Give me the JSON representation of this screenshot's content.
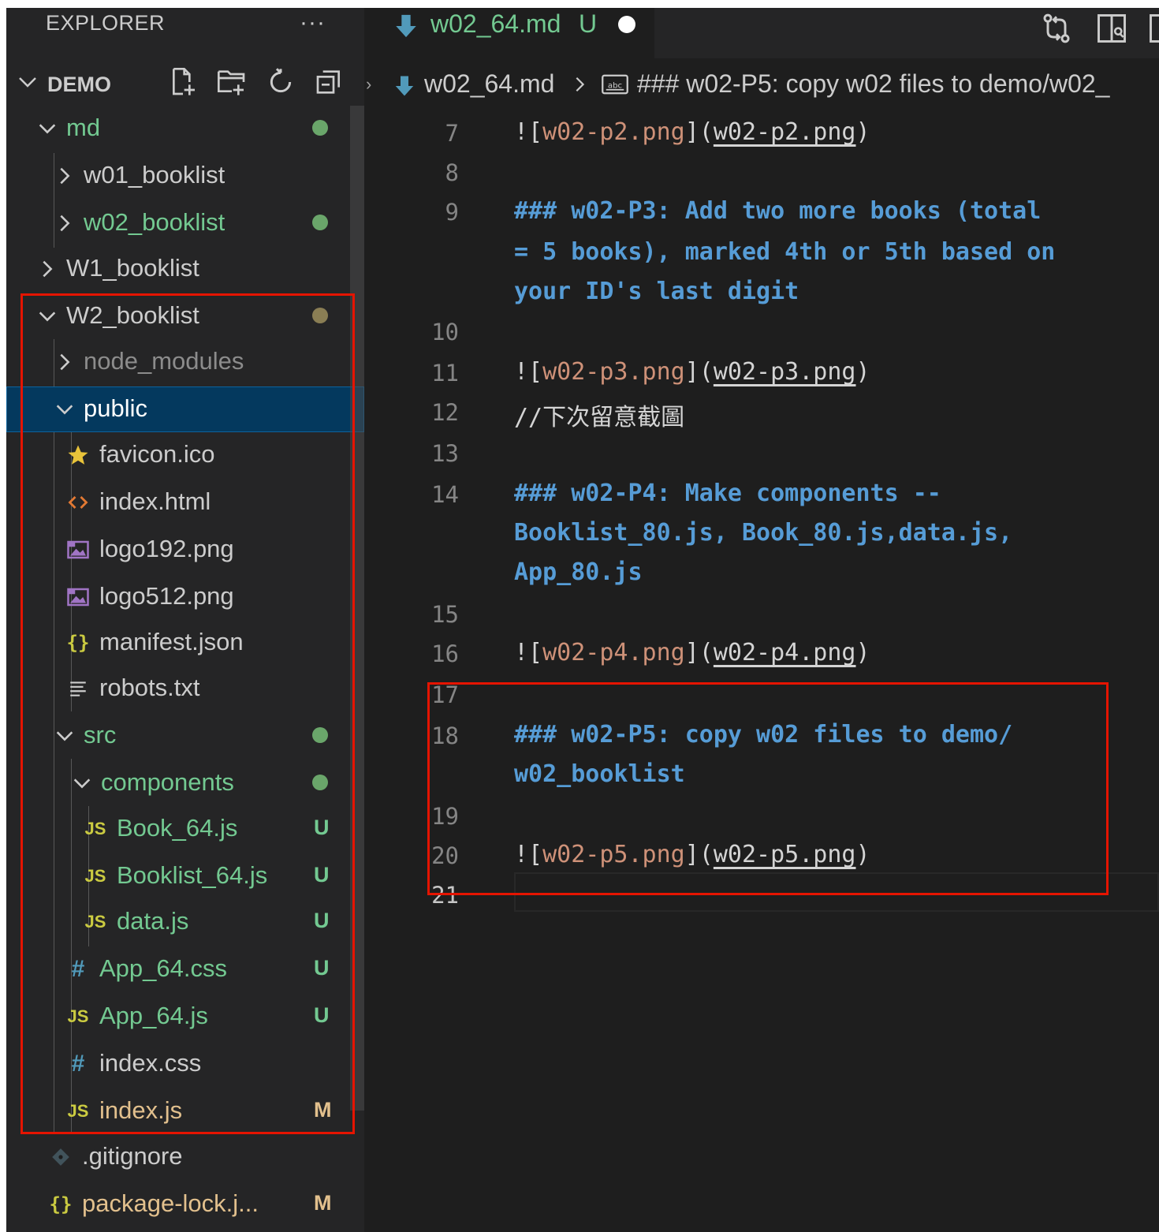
{
  "explorer": {
    "title": "EXPLORER",
    "more": "···",
    "workspace": "DEMO"
  },
  "tree": [
    {
      "label": "md",
      "status": "",
      "dot": "green"
    },
    {
      "label": "w01_booklist",
      "status": ""
    },
    {
      "label": "w02_booklist",
      "status": "",
      "dot": "green"
    },
    {
      "label": "W1_booklist",
      "status": ""
    },
    {
      "label": "W2_booklist",
      "status": "",
      "dot": "olive"
    },
    {
      "label": "node_modules",
      "status": ""
    },
    {
      "label": "public",
      "status": ""
    },
    {
      "label": "favicon.ico",
      "status": ""
    },
    {
      "label": "index.html",
      "status": ""
    },
    {
      "label": "logo192.png",
      "status": ""
    },
    {
      "label": "logo512.png",
      "status": ""
    },
    {
      "label": "manifest.json",
      "status": ""
    },
    {
      "label": "robots.txt",
      "status": ""
    },
    {
      "label": "src",
      "status": "",
      "dot": "green"
    },
    {
      "label": "components",
      "status": "",
      "dot": "green"
    },
    {
      "label": "Book_64.js",
      "status": "U"
    },
    {
      "label": "Booklist_64.js",
      "status": "U"
    },
    {
      "label": "data.js",
      "status": "U"
    },
    {
      "label": "App_64.css",
      "status": "U"
    },
    {
      "label": "App_64.js",
      "status": "U"
    },
    {
      "label": "index.css",
      "status": ""
    },
    {
      "label": "index.js",
      "status": "M"
    },
    {
      "label": ".gitignore",
      "status": ""
    },
    {
      "label": "package-lock.j...",
      "status": "M"
    }
  ],
  "editor": {
    "tab": {
      "name": "w02_64.md",
      "status": "U"
    },
    "breadcrumb": {
      "file": "w02_64.md",
      "heading": "### w02-P5: copy w02 files to demo/w02_"
    },
    "lines": [
      {
        "n": "7",
        "parts": [
          "![",
          "w02-p2.png",
          "](",
          "w02-p2.png",
          ")"
        ]
      },
      {
        "n": "8"
      },
      {
        "n": "9",
        "wrap": [
          "### w02-P3: Add two more books (total",
          "= 5 books), marked 4th or 5th based on",
          "your ID's last digit"
        ]
      },
      {
        "n": "10"
      },
      {
        "n": "11",
        "parts": [
          "![",
          "w02-p3.png",
          "](",
          "w02-p3.png",
          ")"
        ]
      },
      {
        "n": "12",
        "text": "//下次留意截圖"
      },
      {
        "n": "13"
      },
      {
        "n": "14",
        "wrap": [
          "### w02-P4: Make components --",
          "Booklist_80.js, Book_80.js,data.js,",
          "App_80.js"
        ]
      },
      {
        "n": "15"
      },
      {
        "n": "16",
        "parts": [
          "![",
          "w02-p4.png",
          "](",
          "w02-p4.png",
          ")"
        ]
      },
      {
        "n": "17"
      },
      {
        "n": "18",
        "wrap": [
          "### w02-P5: copy w02 files to demo/",
          "w02_booklist"
        ]
      },
      {
        "n": "19"
      },
      {
        "n": "20",
        "parts": [
          "![",
          "w02-p5.png",
          "](",
          "w02-p5.png",
          ")"
        ]
      },
      {
        "n": "21"
      }
    ]
  },
  "colors": {
    "untracked": "#73c991",
    "modified": "#e2c08d",
    "heading": "#569cd6",
    "link_text": "#ce9178",
    "selection": "#04395e",
    "annotation": "#e51400"
  }
}
